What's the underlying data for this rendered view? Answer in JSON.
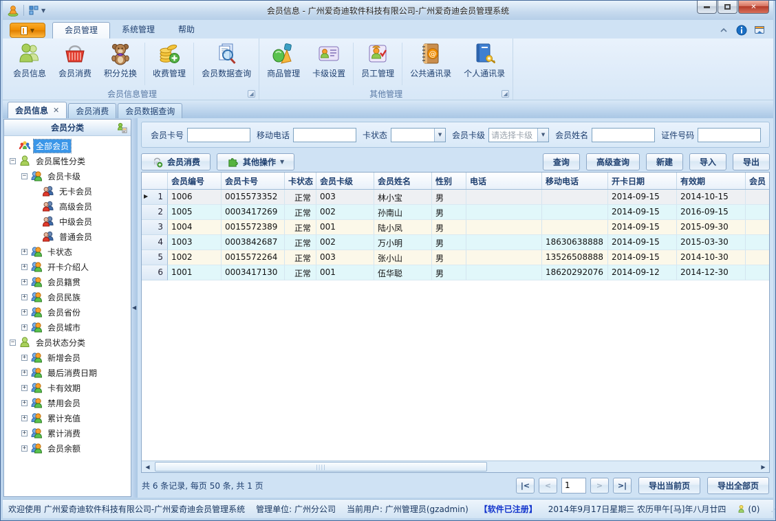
{
  "window": {
    "title": "会员信息 - 广州爱奇迪软件科技有限公司-广州爱奇迪会员管理系统",
    "controls": {
      "minimize": "最小化",
      "maximize": "最大化",
      "close": "关闭"
    }
  },
  "colors": {
    "accent_orange": "#fbab2a",
    "selection_blue": "#3a96e8",
    "row_cream": "#fcf8e9",
    "row_cyan": "#e1f7fa",
    "close_red": "#d5705e"
  },
  "ribbon": {
    "tabs": [
      {
        "label": "会员管理",
        "active": true
      },
      {
        "label": "系统管理",
        "active": false
      },
      {
        "label": "帮助",
        "active": false
      }
    ],
    "groups": [
      {
        "label": "会员信息管理",
        "buttons": [
          {
            "label": "会员信息",
            "icon": "members-icon"
          },
          {
            "label": "会员消费",
            "icon": "shopping-basket-icon"
          },
          {
            "label": "积分兑换",
            "icon": "teddy-bear-icon",
            "sep_after": true
          },
          {
            "label": "收费管理",
            "icon": "coins-icon",
            "sep_after": true
          },
          {
            "label": "会员数据查询",
            "icon": "document-search-icon"
          }
        ]
      },
      {
        "label": "其他管理",
        "buttons": [
          {
            "label": "商品管理",
            "icon": "goods-icon"
          },
          {
            "label": "卡级设置",
            "icon": "card-settings-icon",
            "sep_after": true
          },
          {
            "label": "员工管理",
            "icon": "staff-icon",
            "sep_after": true
          },
          {
            "label": "公共通讯录",
            "icon": "public-contacts-icon"
          },
          {
            "label": "个人通讯录",
            "icon": "personal-contacts-icon"
          }
        ]
      }
    ]
  },
  "doc_tabs": [
    {
      "label": "会员信息",
      "active": true,
      "closable": true
    },
    {
      "label": "会员消费",
      "active": false,
      "closable": false
    },
    {
      "label": "会员数据查询",
      "active": false,
      "closable": false
    }
  ],
  "sidebar": {
    "title": "会员分类",
    "tree": [
      {
        "label": "全部会员",
        "level": 0,
        "expander": "none",
        "icon": "group-icon",
        "selected": true
      },
      {
        "label": "会员属性分类",
        "level": 0,
        "expander": "minus",
        "icon": "person-green-icon"
      },
      {
        "label": "会员卡级",
        "level": 1,
        "expander": "minus",
        "icon": "pair-orange-icon"
      },
      {
        "label": "无卡会员",
        "level": 2,
        "expander": "none",
        "icon": "pair-red-icon"
      },
      {
        "label": "高级会员",
        "level": 2,
        "expander": "none",
        "icon": "pair-red-icon"
      },
      {
        "label": "中级会员",
        "level": 2,
        "expander": "none",
        "icon": "pair-red-icon"
      },
      {
        "label": "普通会员",
        "level": 2,
        "expander": "none",
        "icon": "pair-red-icon"
      },
      {
        "label": "卡状态",
        "level": 1,
        "expander": "plus",
        "icon": "pair-orange-icon"
      },
      {
        "label": "开卡介绍人",
        "level": 1,
        "expander": "plus",
        "icon": "pair-orange-icon"
      },
      {
        "label": "会员籍贯",
        "level": 1,
        "expander": "plus",
        "icon": "pair-orange-icon"
      },
      {
        "label": "会员民族",
        "level": 1,
        "expander": "plus",
        "icon": "pair-orange-icon"
      },
      {
        "label": "会员省份",
        "level": 1,
        "expander": "plus",
        "icon": "pair-orange-icon"
      },
      {
        "label": "会员城市",
        "level": 1,
        "expander": "plus",
        "icon": "pair-orange-icon"
      },
      {
        "label": "会员状态分类",
        "level": 0,
        "expander": "minus",
        "icon": "person-green-icon"
      },
      {
        "label": "新增会员",
        "level": 1,
        "expander": "plus",
        "icon": "pair-orange-icon"
      },
      {
        "label": "最后消费日期",
        "level": 1,
        "expander": "plus",
        "icon": "pair-orange-icon"
      },
      {
        "label": "卡有效期",
        "level": 1,
        "expander": "plus",
        "icon": "pair-orange-icon"
      },
      {
        "label": "禁用会员",
        "level": 1,
        "expander": "plus",
        "icon": "pair-orange-icon"
      },
      {
        "label": "累计充值",
        "level": 1,
        "expander": "plus",
        "icon": "pair-orange-icon"
      },
      {
        "label": "累计消费",
        "level": 1,
        "expander": "plus",
        "icon": "pair-orange-icon"
      },
      {
        "label": "会员余额",
        "level": 1,
        "expander": "plus",
        "icon": "pair-orange-icon"
      }
    ]
  },
  "filters": {
    "card_no": {
      "label": "会员卡号",
      "value": ""
    },
    "mobile": {
      "label": "移动电话",
      "value": ""
    },
    "card_status": {
      "label": "卡状态",
      "value": ""
    },
    "card_level": {
      "label": "会员卡级",
      "placeholder": "请选择卡级"
    },
    "member_name": {
      "label": "会员姓名",
      "value": ""
    },
    "id_number": {
      "label": "证件号码",
      "value": ""
    }
  },
  "toolbar": {
    "member_consume": "会员消费",
    "other_ops": "其他操作",
    "query": "查询",
    "adv_query": "高级查询",
    "new": "新建",
    "import": "导入",
    "export": "导出"
  },
  "grid": {
    "columns": [
      "会员编号",
      "会员卡号",
      "卡状态",
      "会员卡级",
      "会员姓名",
      "性别",
      "电话",
      "移动电话",
      "开卡日期",
      "有效期",
      "会员"
    ],
    "rows": [
      {
        "row_no": "1",
        "current": true,
        "cells": [
          "1006",
          "0015573352",
          "正常",
          "003",
          "林小宝",
          "男",
          "",
          "",
          "2014-09-15",
          "2014-10-15",
          ""
        ]
      },
      {
        "row_no": "2",
        "current": false,
        "cells": [
          "1005",
          "0003417269",
          "正常",
          "002",
          "孙南山",
          "男",
          "",
          "",
          "2014-09-15",
          "2016-09-15",
          ""
        ]
      },
      {
        "row_no": "3",
        "current": false,
        "cells": [
          "1004",
          "0015572389",
          "正常",
          "001",
          "陆小凤",
          "男",
          "",
          "",
          "2014-09-15",
          "2015-09-30",
          ""
        ]
      },
      {
        "row_no": "4",
        "current": false,
        "cells": [
          "1003",
          "0003842687",
          "正常",
          "002",
          "万小明",
          "男",
          "",
          "18630638888",
          "2014-09-15",
          "2015-03-30",
          ""
        ]
      },
      {
        "row_no": "5",
        "current": false,
        "cells": [
          "1002",
          "0015572264",
          "正常",
          "003",
          "张小山",
          "男",
          "",
          "13526508888",
          "2014-09-15",
          "2014-10-30",
          ""
        ]
      },
      {
        "row_no": "6",
        "current": false,
        "cells": [
          "1001",
          "0003417130",
          "正常",
          "001",
          "伍华聪",
          "男",
          "",
          "18620292076",
          "2014-09-12",
          "2014-12-30",
          ""
        ]
      }
    ]
  },
  "pager": {
    "summary": "共 6 条记录, 每页 50 条, 共 1 页",
    "first": "|<",
    "prev": "<",
    "page": "1",
    "next": ">",
    "last": ">|",
    "export_current": "导出当前页",
    "export_all": "导出全部页"
  },
  "statusbar": {
    "welcome": "欢迎使用 广州爱奇迪软件科技有限公司-广州爱奇迪会员管理系统",
    "org": "管理单位: 广州分公司",
    "user": "当前用户: 广州管理员(gzadmin)",
    "registered": "【软件已注册】",
    "datetime": "2014年9月17日星期三 农历甲午[马]年八月廿四",
    "messages": "(0)"
  }
}
